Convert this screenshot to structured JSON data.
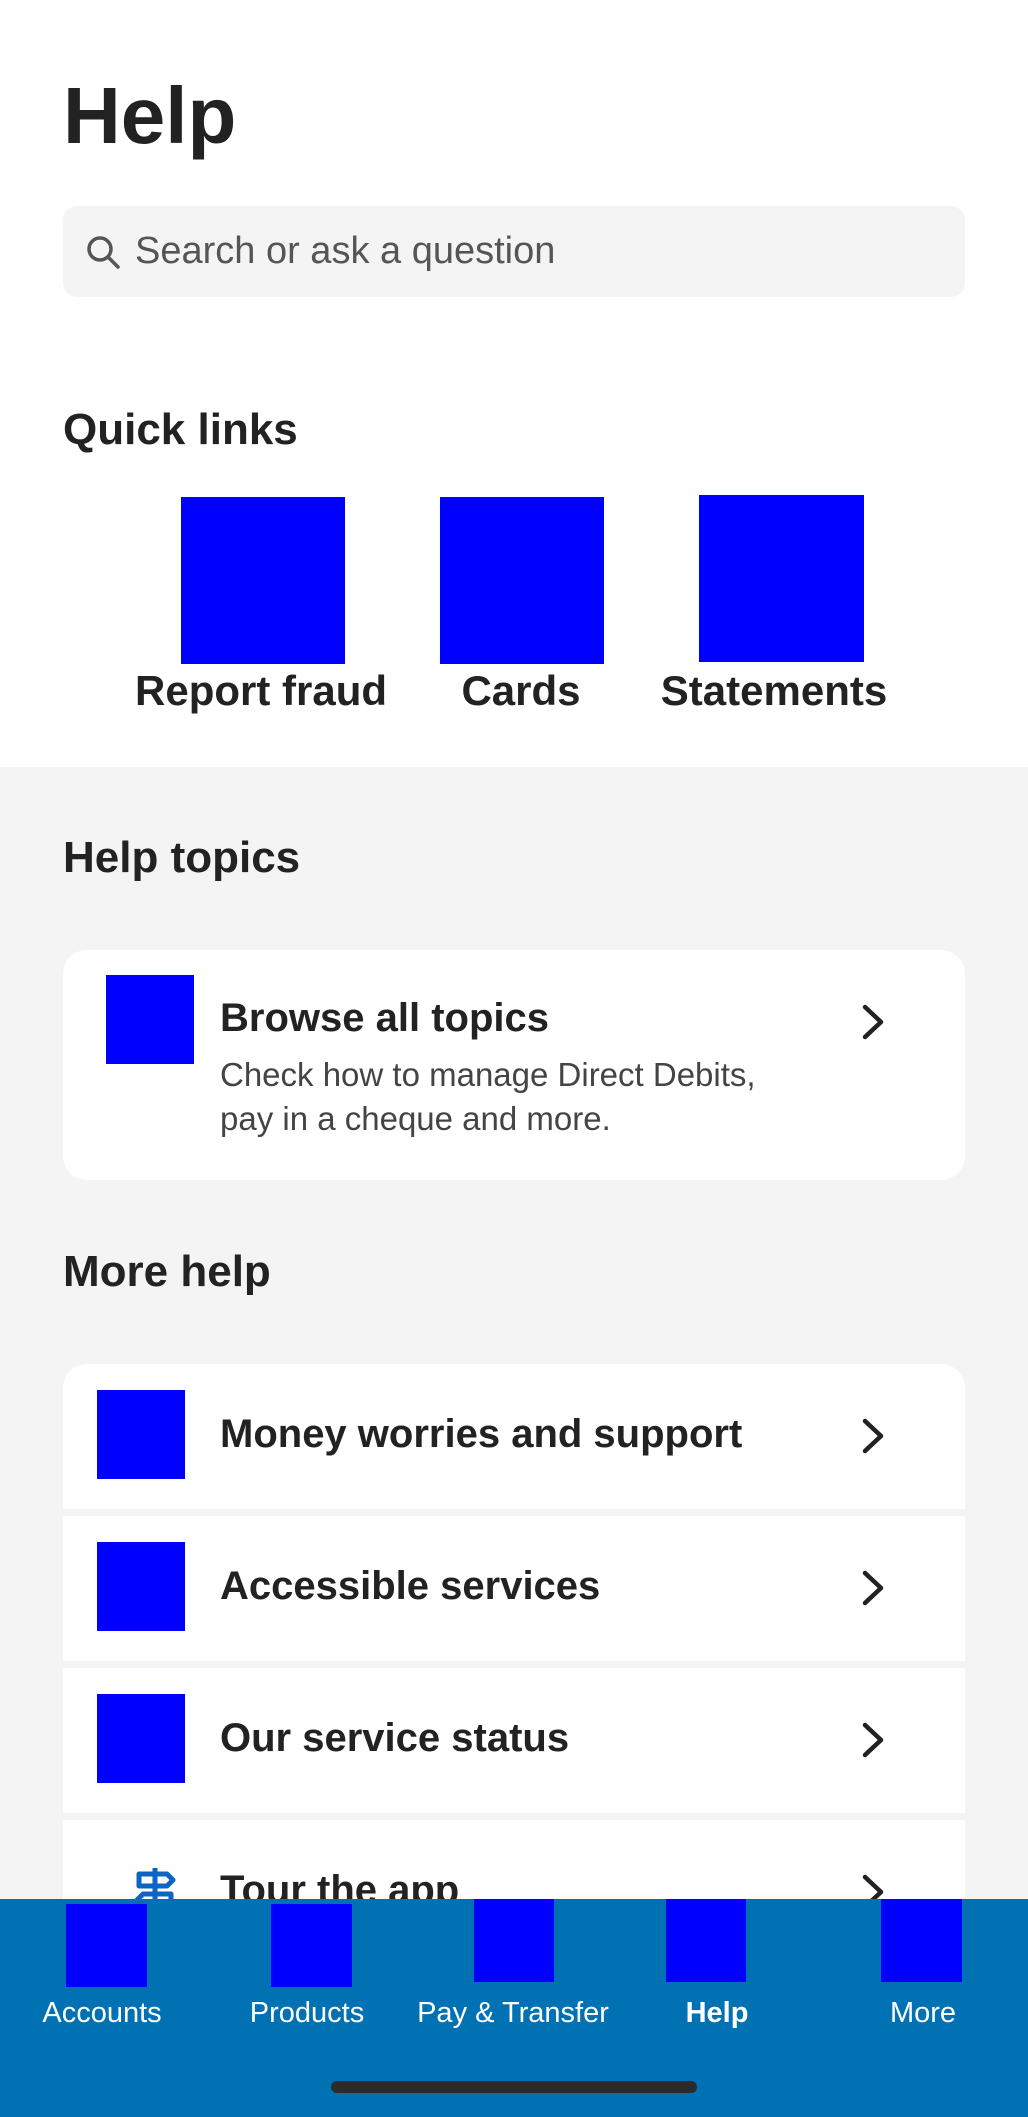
{
  "header": {
    "title": "Help"
  },
  "search": {
    "placeholder": "Search or ask a question",
    "icon": "search-icon"
  },
  "quick_links": {
    "title": "Quick links",
    "items": [
      {
        "label": "Report fraud",
        "icon": "report-fraud-icon"
      },
      {
        "label": "Cards",
        "icon": "cards-icon"
      },
      {
        "label": "Statements",
        "icon": "statements-icon"
      }
    ]
  },
  "help_topics": {
    "title": "Help topics",
    "browse": {
      "title": "Browse all topics",
      "subtitle": "Check how to manage Direct Debits, pay in a cheque and more.",
      "icon": "browse-topics-icon"
    }
  },
  "more_help": {
    "title": "More help",
    "items": [
      {
        "label": "Money worries and support",
        "icon": "money-worries-icon"
      },
      {
        "label": "Accessible services",
        "icon": "accessible-services-icon"
      },
      {
        "label": "Our service status",
        "icon": "service-status-icon"
      },
      {
        "label": "Tour the app",
        "icon": "signpost-icon"
      }
    ]
  },
  "bottom_nav": {
    "items": [
      {
        "label": "Accounts",
        "icon": "accounts-icon",
        "active": false
      },
      {
        "label": "Products",
        "icon": "products-icon",
        "active": false
      },
      {
        "label": "Pay & Transfer",
        "icon": "pay-transfer-icon",
        "active": false
      },
      {
        "label": "Help",
        "icon": "help-icon",
        "active": true
      },
      {
        "label": "More",
        "icon": "more-icon",
        "active": false
      }
    ]
  },
  "colors": {
    "nav_background": "#0071b3",
    "placeholder_icon": "#0000ff",
    "section_background": "#f4f4f4",
    "accent_icon": "#0a66c2"
  }
}
